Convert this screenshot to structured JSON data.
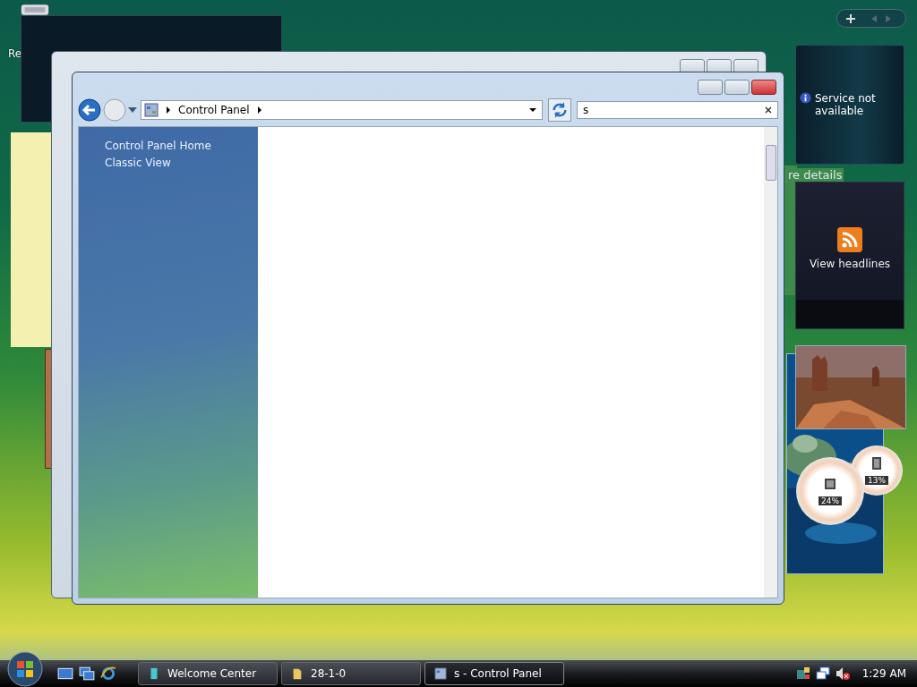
{
  "desktop": {
    "icon_label": "Re"
  },
  "background_window": {
    "text": "re details"
  },
  "window": {
    "address": {
      "crumbs": [
        "Control Panel"
      ]
    },
    "search": {
      "value": "s"
    },
    "sidebar": {
      "links": [
        "Control Panel Home",
        "Classic View"
      ]
    }
  },
  "gadgets": {
    "weather": {
      "message": "Service not available"
    },
    "feed": {
      "label": "View headlines"
    },
    "meters": [
      "24%",
      "13%"
    ]
  },
  "taskbar": {
    "buttons": [
      {
        "label": "Welcome Center",
        "kind": "welcome",
        "selected": false
      },
      {
        "label": "28-1-0",
        "kind": "folder",
        "selected": false
      },
      {
        "label": "s - Control Panel",
        "kind": "control",
        "selected": true
      }
    ],
    "clock": "1:29 AM"
  }
}
